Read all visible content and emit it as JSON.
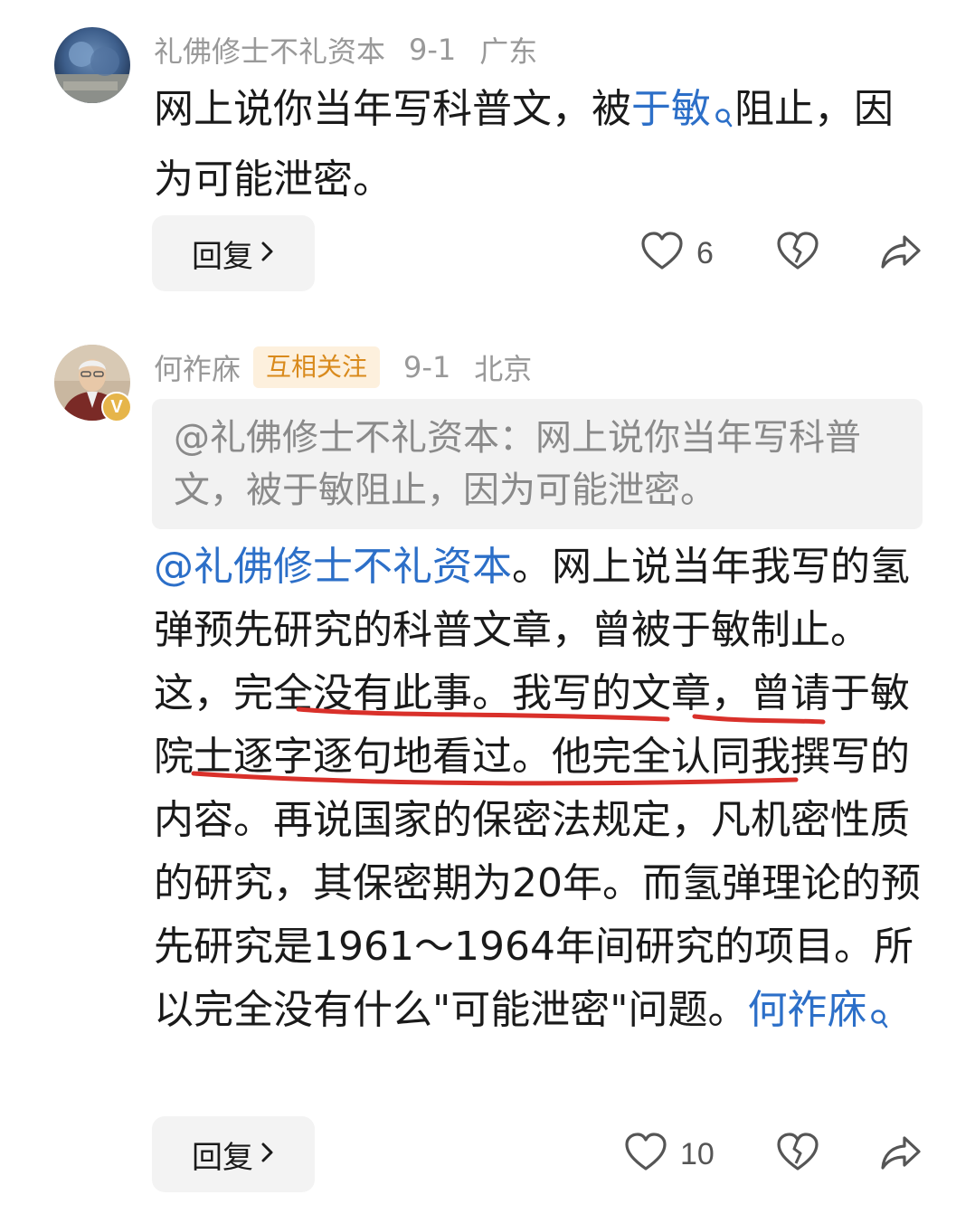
{
  "comments": [
    {
      "user": "礼佛修士不礼资本",
      "date": "9-1",
      "location": "广东",
      "text_parts": {
        "a": "网上说你当年写科普文，被",
        "link": "于敏",
        "b": "阻止，因为可能泄密。"
      },
      "reply_label": "回复",
      "like_count": "6",
      "icons": {
        "like": "heart-icon",
        "dislike": "broken-heart-icon",
        "share": "share-icon",
        "search": "search-icon"
      }
    },
    {
      "user": "何祚庥",
      "tag": "互相关注",
      "date": "9-1",
      "location": "北京",
      "verified_mark": "V",
      "quote": "@礼佛修士不礼资本：网上说你当年写科普文，被于敏阻止，因为可能泄密。",
      "text_parts": {
        "mention": "@礼佛修士不礼资本",
        "l1": "。网上说当年我写的氢弹预先研究的科普文章，曾被于敏制止。",
        "u1": "这，完全没有此事。",
        "u2": "我写的文章，曾请于敏院士逐字逐句地看过",
        "l2": "。他完全认同我撰写的内容。再说国家的保密法规定，凡机密性质的研究，其保密期为20年。而氢弹理论的预先研究是1961～1964年间研究的项目。所以完全没有什么\"可能泄密\"问题。",
        "sign": "何祚庥"
      },
      "reply_label": "回复",
      "like_count": "10",
      "annotation_color": "#d9302a"
    }
  ],
  "colors": {
    "link": "#2c6fc8",
    "meta": "#999999",
    "tag_bg": "#fdf0dd",
    "tag_text": "#d98a1c",
    "quote_bg": "#f2f2f2"
  }
}
